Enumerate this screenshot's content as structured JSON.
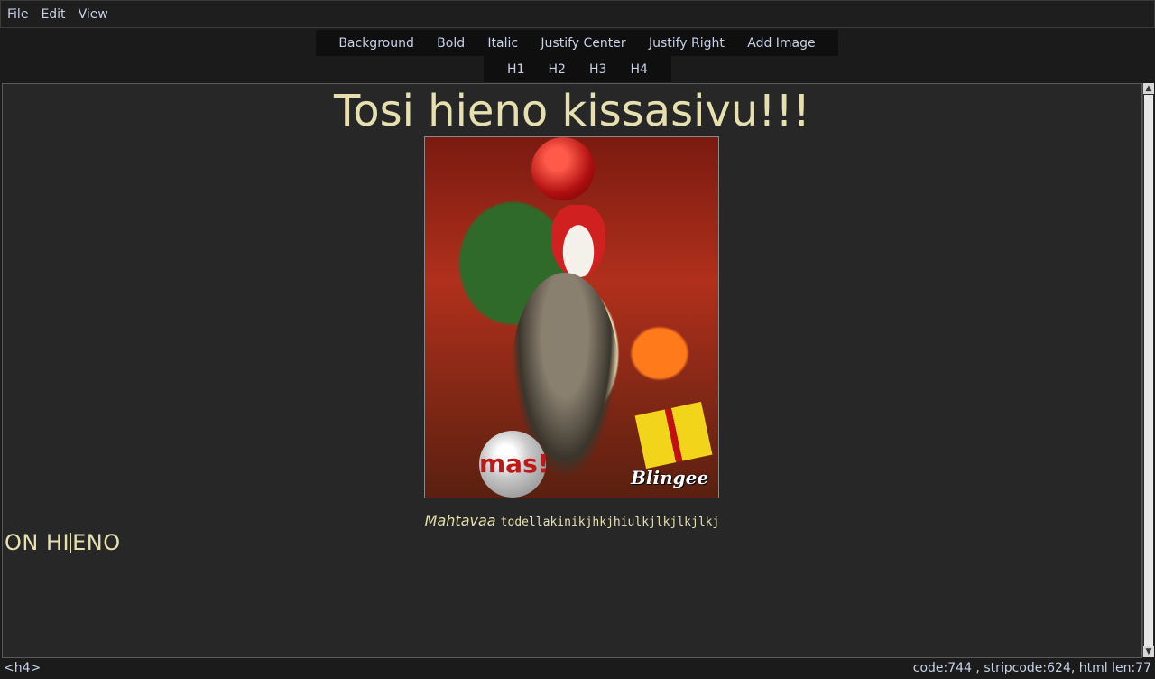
{
  "menu": {
    "file": "File",
    "edit": "Edit",
    "view": "View"
  },
  "toolbar": {
    "row1": [
      "Background",
      "Bold",
      "Italic",
      "Justify Center",
      "Justify Right",
      "Add Image"
    ],
    "row2": [
      "H1",
      "H2",
      "H3",
      "H4"
    ]
  },
  "document": {
    "title": "Tosi hieno kissasivu!!!",
    "image_watermark": "Blingee",
    "image_ball_text": "mas!",
    "caption_italic": "Mahtavaa",
    "caption_mono": "todellakinikjhkjhiulkjlkjlkjlkj",
    "h4_before_caret": "ON HI",
    "h4_after_caret": "ENO"
  },
  "status": {
    "tag": "<h4>",
    "info": "code:744 , stripcode:624, html len:77"
  },
  "colors": {
    "background": "#1b1b1b",
    "editor_bg": "#272727",
    "text": "#e6e0b0",
    "ui_text": "#c8d0e8",
    "toolbar_bg": "#0f0f0f"
  }
}
